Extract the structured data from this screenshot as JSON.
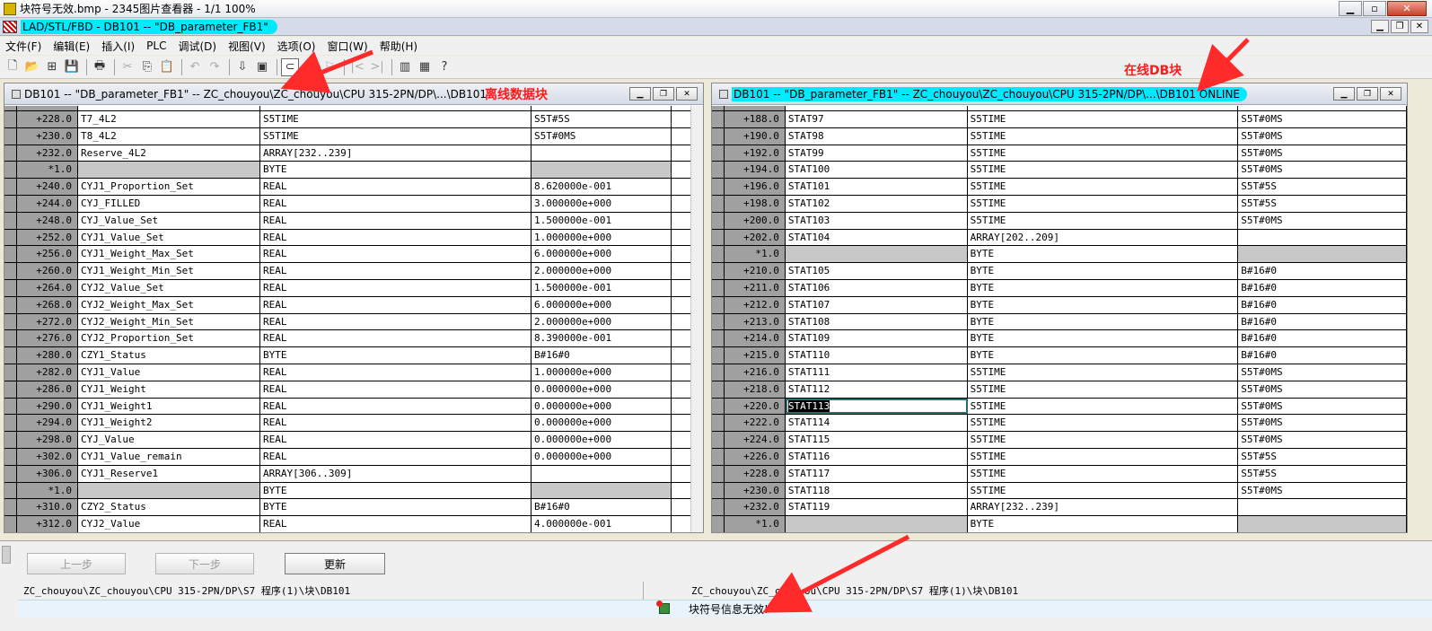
{
  "window": {
    "title": "块符号无效.bmp - 2345图片查看器 - 1/1 100%"
  },
  "app": {
    "title": "LAD/STL/FBD  - DB101 -- \"DB_parameter_FB1\""
  },
  "menu": [
    "文件(F)",
    "编辑(E)",
    "插入(I)",
    "PLC",
    "调试(D)",
    "视图(V)",
    "选项(O)",
    "窗口(W)",
    "帮助(H)"
  ],
  "left_panel": {
    "title": "DB101 -- \"DB_parameter_FB1\" -- ZC_chouyou\\ZC_chouyou\\CPU 315-2PN/DP\\...\\DB101",
    "annotation": "离线数据块",
    "rows": [
      [
        "+228.0",
        "T7_4L2",
        "S5TIME",
        "S5T#5S"
      ],
      [
        "+230.0",
        "T8_4L2",
        "S5TIME",
        "S5T#0MS"
      ],
      [
        "+232.0",
        "Reserve_4L2",
        "ARRAY[232..239]",
        ""
      ],
      [
        "*1.0",
        "",
        "BYTE",
        ""
      ],
      [
        "+240.0",
        "CYJ1_Proportion_Set",
        "REAL",
        "8.620000e-001"
      ],
      [
        "+244.0",
        "CYJ_FILLED",
        "REAL",
        "3.000000e+000"
      ],
      [
        "+248.0",
        "CYJ_Value_Set",
        "REAL",
        "1.500000e-001"
      ],
      [
        "+252.0",
        "CYJ1_Value_Set",
        "REAL",
        "1.000000e+000"
      ],
      [
        "+256.0",
        "CYJ1_Weight_Max_Set",
        "REAL",
        "6.000000e+000"
      ],
      [
        "+260.0",
        "CYJ1_Weight_Min_Set",
        "REAL",
        "2.000000e+000"
      ],
      [
        "+264.0",
        "CYJ2_Value_Set",
        "REAL",
        "1.500000e-001"
      ],
      [
        "+268.0",
        "CYJ2_Weight_Max_Set",
        "REAL",
        "6.000000e+000"
      ],
      [
        "+272.0",
        "CYJ2_Weight_Min_Set",
        "REAL",
        "2.000000e+000"
      ],
      [
        "+276.0",
        "CYJ2_Proportion_Set",
        "REAL",
        "8.390000e-001"
      ],
      [
        "+280.0",
        "CZY1_Status",
        "BYTE",
        "B#16#0"
      ],
      [
        "+282.0",
        "CYJ1_Value",
        "REAL",
        "1.000000e+000"
      ],
      [
        "+286.0",
        "CYJ1_Weight",
        "REAL",
        "0.000000e+000"
      ],
      [
        "+290.0",
        "CYJ1_Weight1",
        "REAL",
        "0.000000e+000"
      ],
      [
        "+294.0",
        "CYJ1_Weight2",
        "REAL",
        "0.000000e+000"
      ],
      [
        "+298.0",
        "CYJ_Value",
        "REAL",
        "0.000000e+000"
      ],
      [
        "+302.0",
        "CYJ1_Value_remain",
        "REAL",
        "0.000000e+000"
      ],
      [
        "+306.0",
        "CYJ1_Reserve1",
        "ARRAY[306..309]",
        ""
      ],
      [
        "*1.0",
        "",
        "BYTE",
        ""
      ],
      [
        "+310.0",
        "CZY2_Status",
        "BYTE",
        "B#16#0"
      ],
      [
        "+312.0",
        "CYJ2_Value",
        "REAL",
        "4.000000e-001"
      ]
    ]
  },
  "right_panel": {
    "title": "DB101 -- \"DB_parameter_FB1\" -- ZC_chouyou\\ZC_chouyou\\CPU 315-2PN/DP\\...\\DB101  ONLINE",
    "annotation": "在线DB块",
    "selected_cell": "STAT113",
    "rows": [
      [
        "+188.0",
        "STAT97",
        "S5TIME",
        "S5T#0MS"
      ],
      [
        "+190.0",
        "STAT98",
        "S5TIME",
        "S5T#0MS"
      ],
      [
        "+192.0",
        "STAT99",
        "S5TIME",
        "S5T#0MS"
      ],
      [
        "+194.0",
        "STAT100",
        "S5TIME",
        "S5T#0MS"
      ],
      [
        "+196.0",
        "STAT101",
        "S5TIME",
        "S5T#5S"
      ],
      [
        "+198.0",
        "STAT102",
        "S5TIME",
        "S5T#5S"
      ],
      [
        "+200.0",
        "STAT103",
        "S5TIME",
        "S5T#0MS"
      ],
      [
        "+202.0",
        "STAT104",
        "ARRAY[202..209]",
        ""
      ],
      [
        "*1.0",
        "",
        "BYTE",
        ""
      ],
      [
        "+210.0",
        "STAT105",
        "BYTE",
        "B#16#0"
      ],
      [
        "+211.0",
        "STAT106",
        "BYTE",
        "B#16#0"
      ],
      [
        "+212.0",
        "STAT107",
        "BYTE",
        "B#16#0"
      ],
      [
        "+213.0",
        "STAT108",
        "BYTE",
        "B#16#0"
      ],
      [
        "+214.0",
        "STAT109",
        "BYTE",
        "B#16#0"
      ],
      [
        "+215.0",
        "STAT110",
        "BYTE",
        "B#16#0"
      ],
      [
        "+216.0",
        "STAT111",
        "S5TIME",
        "S5T#0MS"
      ],
      [
        "+218.0",
        "STAT112",
        "S5TIME",
        "S5T#0MS"
      ],
      [
        "+220.0",
        "STAT113",
        "S5TIME",
        "S5T#0MS"
      ],
      [
        "+222.0",
        "STAT114",
        "S5TIME",
        "S5T#0MS"
      ],
      [
        "+224.0",
        "STAT115",
        "S5TIME",
        "S5T#0MS"
      ],
      [
        "+226.0",
        "STAT116",
        "S5TIME",
        "S5T#5S"
      ],
      [
        "+228.0",
        "STAT117",
        "S5TIME",
        "S5T#5S"
      ],
      [
        "+230.0",
        "STAT118",
        "S5TIME",
        "S5T#0MS"
      ],
      [
        "+232.0",
        "STAT119",
        "ARRAY[232..239]",
        ""
      ],
      [
        "*1.0",
        "",
        "BYTE",
        ""
      ]
    ]
  },
  "bottom": {
    "prev_label": "上一步",
    "next_label": "下一步",
    "update_label": "更新",
    "left_path": "ZC_chouyou\\ZC_chouyou\\CPU 315-2PN/DP\\S7 程序(1)\\块\\DB101",
    "right_path": "ZC_chouyou\\ZC_chouyou\\CPU 315-2PN/DP\\S7 程序(1)\\块\\DB101",
    "status": "块符号信息无效!"
  },
  "colors": {
    "highlight": "#00eaff",
    "annotation": "#ff1a1a",
    "header_cell": "#a0a0a0"
  },
  "icons": [
    "new-icon",
    "open-icon",
    "save-icon",
    "print-icon",
    "cut-icon",
    "copy-icon",
    "paste-icon",
    "undo-icon",
    "redo-icon",
    "help-icon"
  ]
}
